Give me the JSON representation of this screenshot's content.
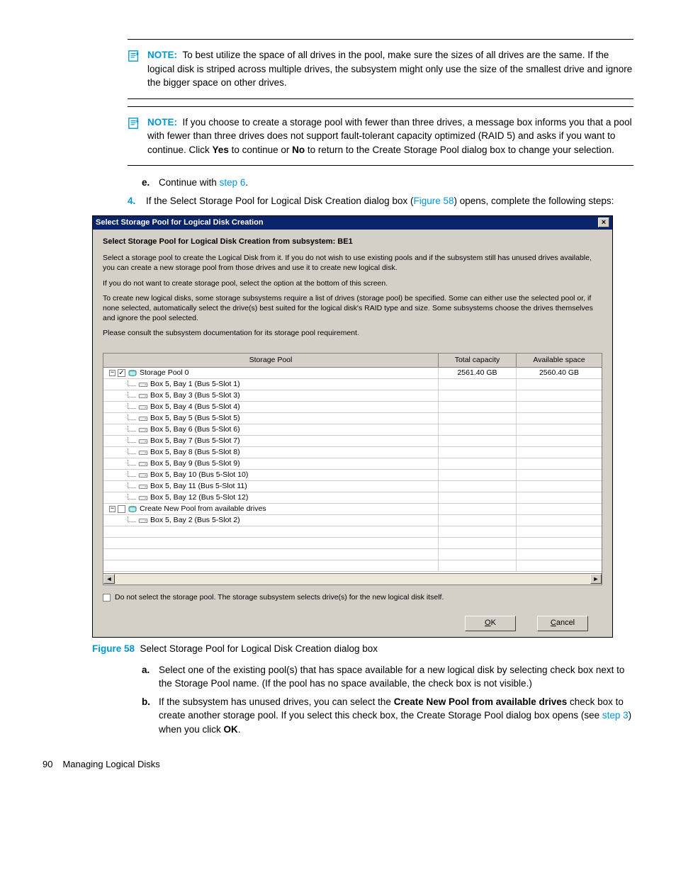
{
  "note1": {
    "label": "NOTE:",
    "text": "To best utilize the space of all drives in the pool, make sure the sizes of all drives are the same. If the logical disk is striped across multiple drives, the subsystem might only use the size of the smallest drive and ignore the bigger space on other drives."
  },
  "note2": {
    "label": "NOTE:",
    "text_a": "If you choose to create a storage pool with fewer than three drives, a message box informs you that a pool with fewer than three drives does not support fault-tolerant capacity optimized (RAID 5) and asks if you want to continue. Click ",
    "yes": "Yes",
    "text_b": " to continue or ",
    "no": "No",
    "text_c": " to return to the Create Storage Pool dialog box to change your selection."
  },
  "step_e": {
    "marker": "e.",
    "text_a": "Continue with ",
    "link": "step 6",
    "text_b": "."
  },
  "step_4": {
    "marker": "4.",
    "text_a": "If the Select Storage Pool for Logical Disk Creation dialog box (",
    "link": "Figure 58",
    "text_b": ") opens, complete the following steps:"
  },
  "dialog": {
    "title": "Select Storage Pool for Logical Disk Creation",
    "close": "×",
    "heading": "Select Storage Pool for Logical Disk Creation from subsystem: BE1",
    "para1": "Select a storage pool to create the Logical Disk from it. If you do not wish to use existing pools and if the subsystem still has unused drives available, you can create a new storage pool from those drives and use it to create new logical disk.",
    "para2": "If you do not want to create storage pool, select the option at the bottom of this screen.",
    "para3": "To create new logical disks, some storage subsystems require a list of drives (storage pool) be specified. Some can either use the selected pool or, if none selected, automatically select the drive(s) best suited for the logical disk's RAID type and size. Some subsystems choose the drives themselves and ignore the pool selected.",
    "para4": "Please consult the subsystem documentation for its storage pool requirement.",
    "columns": {
      "pool": "Storage Pool",
      "cap": "Total capacity",
      "avail": "Available space"
    },
    "pool0": {
      "name": "Storage Pool 0",
      "cap": "2561.40 GB",
      "avail": "2560.40 GB"
    },
    "drives": [
      "Box 5, Bay 1 (Bus 5-Slot 1)",
      "Box 5, Bay 3 (Bus 5-Slot 3)",
      "Box 5, Bay 4 (Bus 5-Slot 4)",
      "Box 5, Bay 5 (Bus 5-Slot 5)",
      "Box 5, Bay 6 (Bus 5-Slot 6)",
      "Box 5, Bay 7 (Bus 5-Slot 7)",
      "Box 5, Bay 8 (Bus 5-Slot 8)",
      "Box 5, Bay 9 (Bus 5-Slot 9)",
      "Box 5, Bay 10 (Bus 5-Slot 10)",
      "Box 5, Bay 11 (Bus 5-Slot 11)",
      "Box 5, Bay 12 (Bus 5-Slot 12)"
    ],
    "newpool": {
      "name": "Create New Pool from available drives"
    },
    "newpool_drive": "Box 5, Bay 2 (Bus 5-Slot 2)",
    "bottom_check": "Do not select the storage pool. The storage subsystem selects drive(s) for the new logical disk itself.",
    "ok": "OK",
    "ok_u": "O",
    "ok_rest": "K",
    "cancel": "Cancel",
    "cancel_u": "C",
    "cancel_rest": "ancel",
    "scroll_left": "◄",
    "scroll_right": "►"
  },
  "figcap": {
    "num": "Figure 58",
    "text": "Select Storage Pool for Logical Disk Creation dialog box"
  },
  "sub_a": {
    "marker": "a.",
    "text": "Select one of the existing pool(s) that has space available for a new logical disk by selecting check box next to the Storage Pool name. (If the pool has no space available, the check box is not visible.)"
  },
  "sub_b": {
    "marker": "b.",
    "text_a": "If the subsystem has unused drives, you can select the ",
    "bold1": "Create New Pool from available drives",
    "text_b": " check box to create another storage pool. If you select this check box, the Create Storage Pool dialog box opens (see ",
    "link": "step 3",
    "text_c": ") when you click ",
    "bold2": "OK",
    "text_d": "."
  },
  "footer": {
    "page": "90",
    "title": "Managing Logical Disks"
  }
}
